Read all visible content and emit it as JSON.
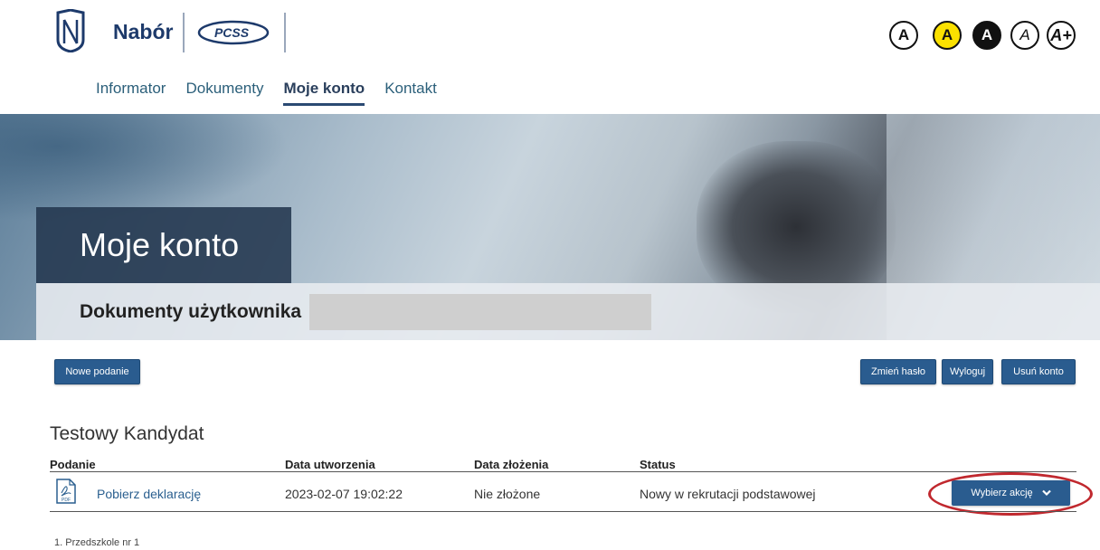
{
  "header": {
    "brand": "Nabór",
    "partner_logo_text": "PCSS",
    "accessibility": [
      "A",
      "A",
      "A",
      "A",
      "A+"
    ]
  },
  "nav": {
    "items": [
      "Informator",
      "Dokumenty",
      "Moje konto",
      "Kontakt"
    ],
    "active": "Moje konto"
  },
  "hero": {
    "title": "Moje konto",
    "subtitle": "Dokumenty użytkownika"
  },
  "toolbar": {
    "new_label": "Nowe podanie",
    "change_password_label": "Zmień hasło",
    "logout_label": "Wyloguj",
    "delete_account_label": "Usuń konto"
  },
  "candidate": {
    "name": "Testowy Kandydat"
  },
  "table": {
    "columns": [
      "Podanie",
      "Data utworzenia",
      "Data złożenia",
      "Status"
    ],
    "rows": [
      {
        "document": "Pobierz deklarację",
        "created": "2023-02-07 19:02:22",
        "submitted": "Nie złożone",
        "status": "Nowy w rekrutacji podstawowej",
        "action_label": "Wybierz akcję"
      }
    ]
  },
  "footnote": "1. Przedszkole nr 1",
  "colors": {
    "primary": "#2a5c8f",
    "highlight": "#c0282e",
    "yellow": "#fbe100"
  }
}
